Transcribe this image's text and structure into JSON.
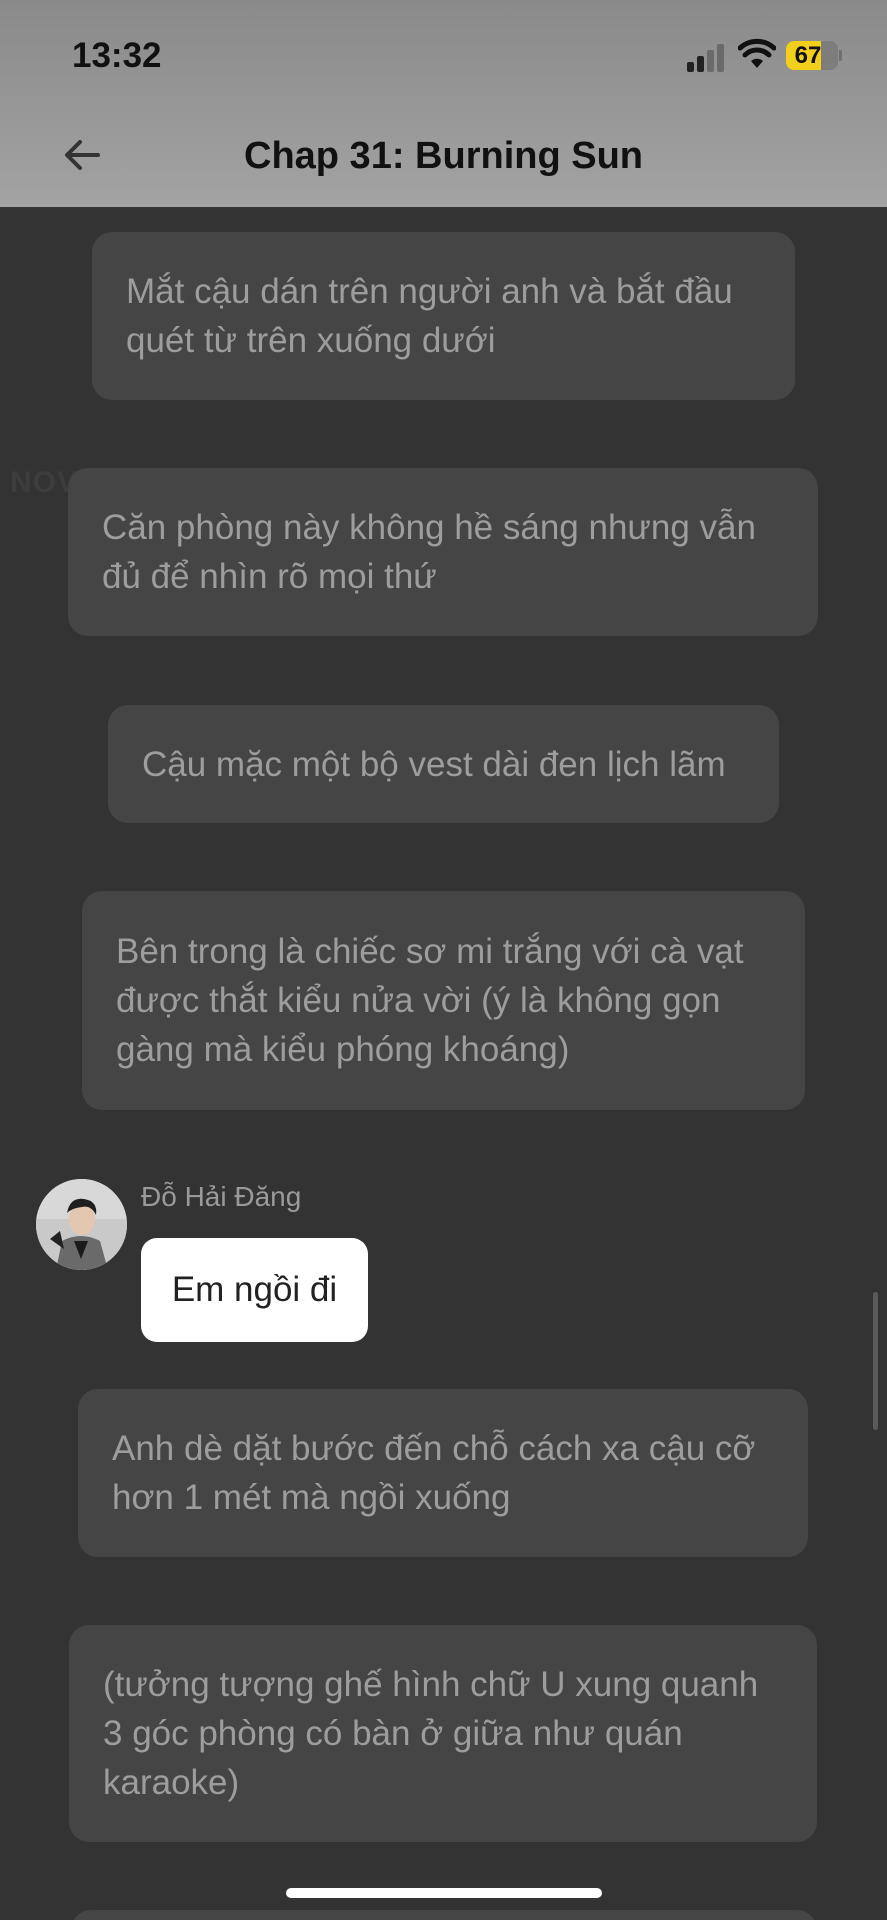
{
  "status_bar": {
    "time": "13:32",
    "battery": "67",
    "battery_level_percent": 67,
    "signal_bars_active": 2,
    "icons": [
      "signal-icon",
      "wifi-icon",
      "battery-icon"
    ]
  },
  "header": {
    "title": "Chap 31: Burning Sun",
    "back_icon": "arrow-left-icon"
  },
  "watermark": "NOVELTOON",
  "narrations": [
    "Mắt cậu dán trên người anh và bắt đầu quét từ trên xuống dưới",
    "Căn phòng này không hề sáng nhưng vẫn đủ để nhìn rõ mọi thứ",
    "Cậu mặc một bộ vest dài đen lịch lãm",
    "Bên trong là chiếc sơ mi trắng với cà vạt được thắt kiểu nửa vời (ý là không gọn gàng mà kiểu phóng khoáng)",
    "Anh dè dặt bước đến chỗ cách xa cậu cỡ hơn 1 mét mà ngồi xuống",
    "(tưởng tượng ghế hình chữ U xung quanh 3 góc phòng có bàn ở giữa như quán karaoke)"
  ],
  "dialogue": {
    "speaker": "Đỗ Hải Đăng",
    "text": "Em ngồi đi"
  },
  "colors": {
    "background": "#333333",
    "narration_bubble": "#454545",
    "narration_text": "#9d9d9d",
    "header": "#9a9a9a",
    "battery_accent": "#f2cf1a",
    "speech_bubble": "#ffffff"
  }
}
